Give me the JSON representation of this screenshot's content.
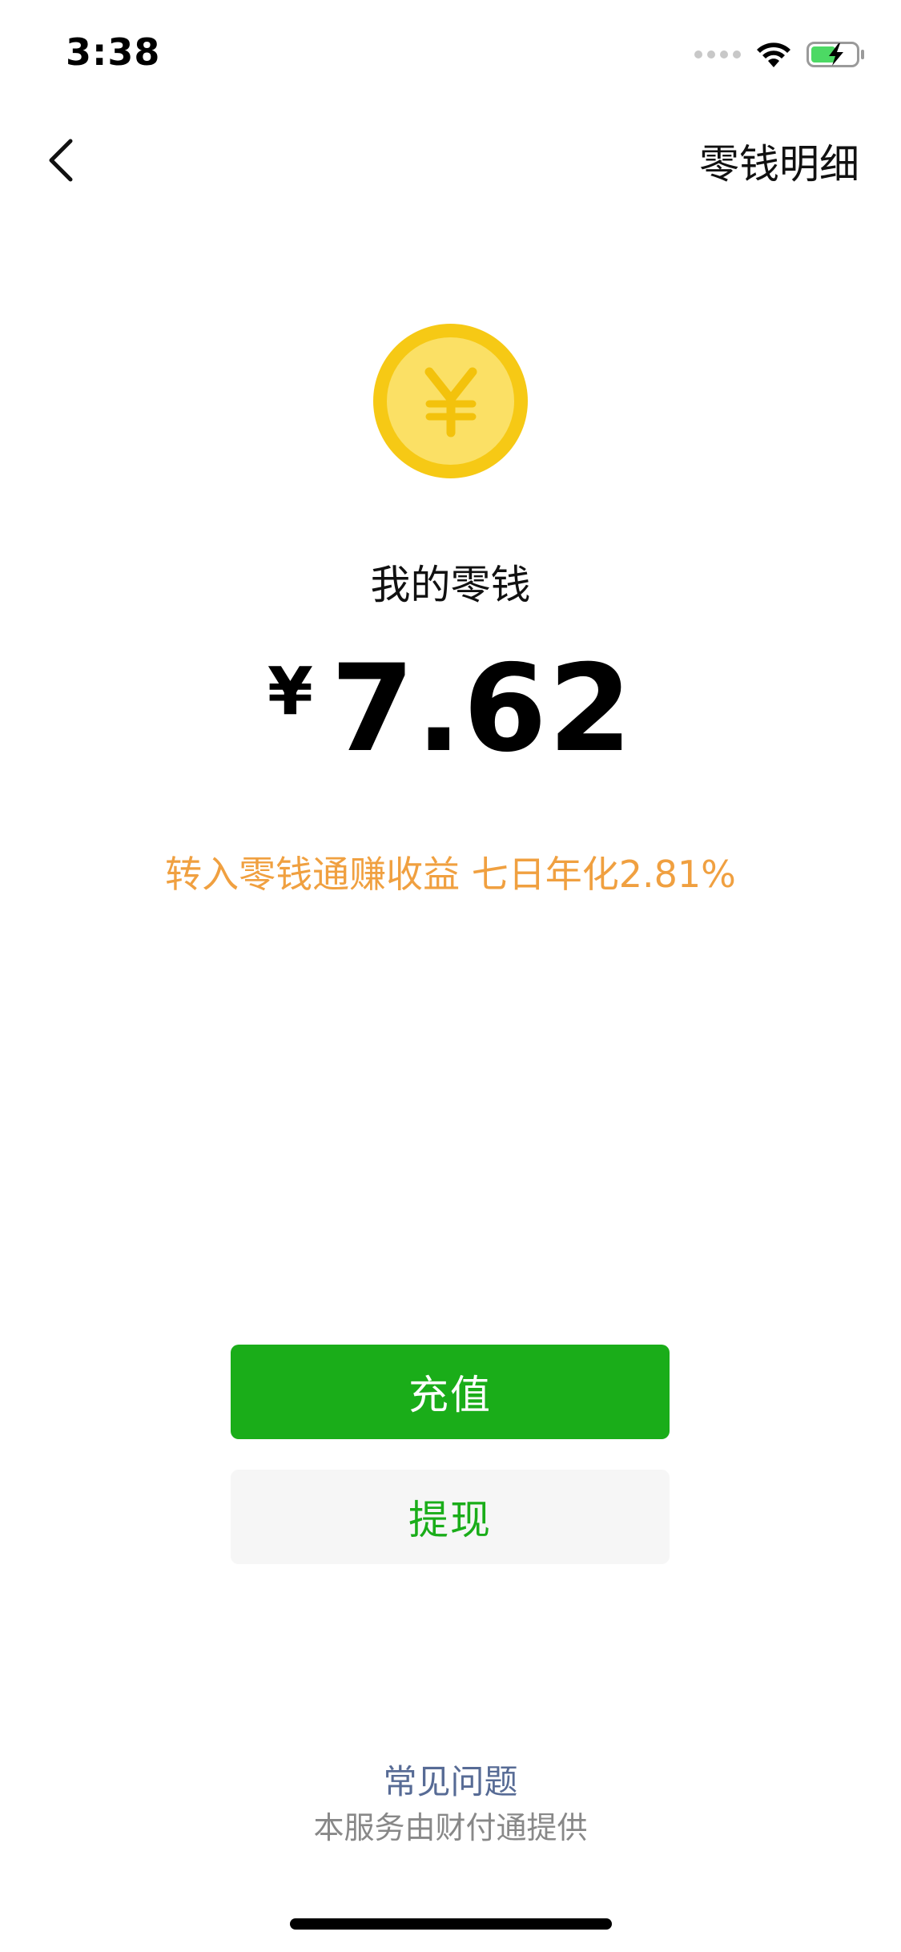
{
  "status_bar": {
    "time": "3:38",
    "icons": [
      "signal-dots-icon",
      "wifi-icon",
      "battery-charging-icon"
    ],
    "battery_color": "#4cd964"
  },
  "nav": {
    "back_icon": "chevron-left-icon",
    "right_action": "零钱明细"
  },
  "wallet": {
    "icon": "yuan-coin-icon",
    "label": "我的零钱",
    "currency_symbol": "¥",
    "amount": "7.62",
    "promo": "转入零钱通赚收益 七日年化2.81%"
  },
  "actions": {
    "topup": "充值",
    "withdraw": "提现"
  },
  "footer": {
    "faq": "常见问题",
    "provider": "本服务由财付通提供"
  },
  "colors": {
    "primary_green": "#1aad19",
    "promo_orange": "#f0a040",
    "link_blue": "#576b95",
    "coin_outer": "#f6c915",
    "coin_inner": "#fbe065"
  }
}
